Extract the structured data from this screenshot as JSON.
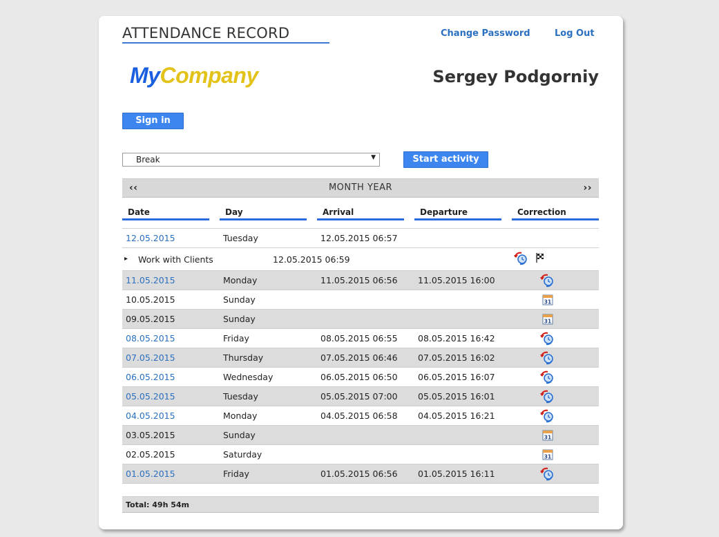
{
  "header": {
    "title": "ATTENDANCE RECORD",
    "change_password": "Change Password",
    "log_out": "Log Out"
  },
  "logo": {
    "part1": "My",
    "part2": "Company"
  },
  "user": {
    "name": "Sergey Podgorniy"
  },
  "sign_in_label": "Sign in",
  "activity": {
    "selected": "Break",
    "start_label": "Start activity"
  },
  "month_nav": {
    "prev": "‹‹",
    "label": "MONTH YEAR",
    "next": "››"
  },
  "columns": [
    "Date",
    "Day",
    "Arrival",
    "Departure",
    "Correction"
  ],
  "rows": [
    {
      "date": "12.05.2015",
      "day": "Tuesday",
      "arrival": "12.05.2015 06:57",
      "departure": "",
      "icon": "none",
      "link": true,
      "shade": false
    },
    {
      "date": "11.05.2015",
      "day": "Monday",
      "arrival": "11.05.2015 06:56",
      "departure": "11.05.2015 16:00",
      "icon": "clock-correction-icon",
      "link": true,
      "shade": true
    },
    {
      "date": "10.05.2015",
      "day": "Sunday",
      "arrival": "",
      "departure": "",
      "icon": "calendar-icon",
      "link": false,
      "shade": false
    },
    {
      "date": "09.05.2015",
      "day": "Sunday",
      "arrival": "",
      "departure": "",
      "icon": "calendar-icon",
      "link": false,
      "shade": true
    },
    {
      "date": "08.05.2015",
      "day": "Friday",
      "arrival": "08.05.2015 06:55",
      "departure": "08.05.2015 16:42",
      "icon": "clock-correction-icon",
      "link": true,
      "shade": false
    },
    {
      "date": "07.05.2015",
      "day": "Thursday",
      "arrival": "07.05.2015 06:46",
      "departure": "07.05.2015 16:02",
      "icon": "clock-correction-icon",
      "link": true,
      "shade": true
    },
    {
      "date": "06.05.2015",
      "day": "Wednesday",
      "arrival": "06.05.2015 06:50",
      "departure": "06.05.2015 16:07",
      "icon": "clock-correction-icon",
      "link": true,
      "shade": false
    },
    {
      "date": "05.05.2015",
      "day": "Tuesday",
      "arrival": "05.05.2015 07:00",
      "departure": "05.05.2015 16:01",
      "icon": "clock-correction-icon",
      "link": true,
      "shade": true
    },
    {
      "date": "04.05.2015",
      "day": "Monday",
      "arrival": "04.05.2015 06:58",
      "departure": "04.05.2015 16:21",
      "icon": "clock-correction-icon",
      "link": true,
      "shade": false
    },
    {
      "date": "03.05.2015",
      "day": "Sunday",
      "arrival": "",
      "departure": "",
      "icon": "calendar-icon",
      "link": false,
      "shade": true
    },
    {
      "date": "02.05.2015",
      "day": "Saturday",
      "arrival": "",
      "departure": "",
      "icon": "calendar-icon",
      "link": false,
      "shade": false
    },
    {
      "date": "01.05.2015",
      "day": "Friday",
      "arrival": "01.05.2015 06:56",
      "departure": "01.05.2015 16:11",
      "icon": "clock-correction-icon",
      "link": true,
      "shade": true
    }
  ],
  "sub_activity": {
    "marker": "▸",
    "name": "Work with Clients",
    "time": "12.05.2015 06:59"
  },
  "calendar_day": "31",
  "total": "Total: 49h 54m",
  "colors": {
    "accent": "#3d86f0",
    "link": "#2a6fc0",
    "logo_blue": "#1a5fe0",
    "logo_yellow": "#e3c21a",
    "row_shade": "#dcdcdc"
  }
}
